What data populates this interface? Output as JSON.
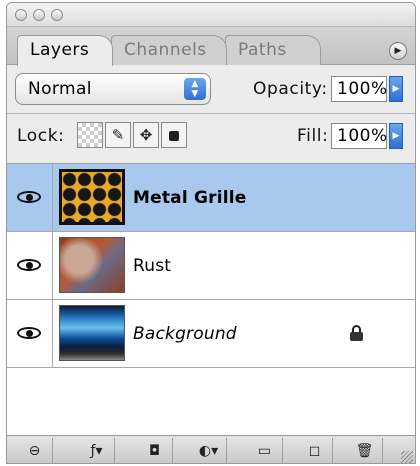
{
  "tabs": [
    {
      "label": "Layers",
      "active": true
    },
    {
      "label": "Channels",
      "active": false
    },
    {
      "label": "Paths",
      "active": false
    }
  ],
  "panel_menu_icon": "triangle-right-icon",
  "blend_mode": {
    "value": "Normal"
  },
  "opacity": {
    "label": "Opacity:",
    "value": "100%"
  },
  "lock": {
    "label": "Lock:",
    "icons": [
      "transparency-lock-icon",
      "brush-lock-icon",
      "move-lock-icon",
      "padlock-icon"
    ]
  },
  "fill": {
    "label": "Fill:",
    "value": "100%"
  },
  "layers": [
    {
      "name": "Metal Grille",
      "selected": true,
      "visible": true,
      "style": "bold"
    },
    {
      "name": "Rust",
      "selected": false,
      "visible": true,
      "style": "normal"
    },
    {
      "name": "Background",
      "selected": false,
      "visible": true,
      "style": "italic",
      "locked": true
    }
  ],
  "toolbar": {
    "icons": [
      "link-icon",
      "layer-style-icon",
      "layer-mask-icon",
      "adjustment-layer-icon",
      "folder-icon",
      "new-layer-icon",
      "trash-icon"
    ]
  },
  "colors": {
    "selection": "#a8c8ee",
    "accent": "#2f6fd0"
  }
}
